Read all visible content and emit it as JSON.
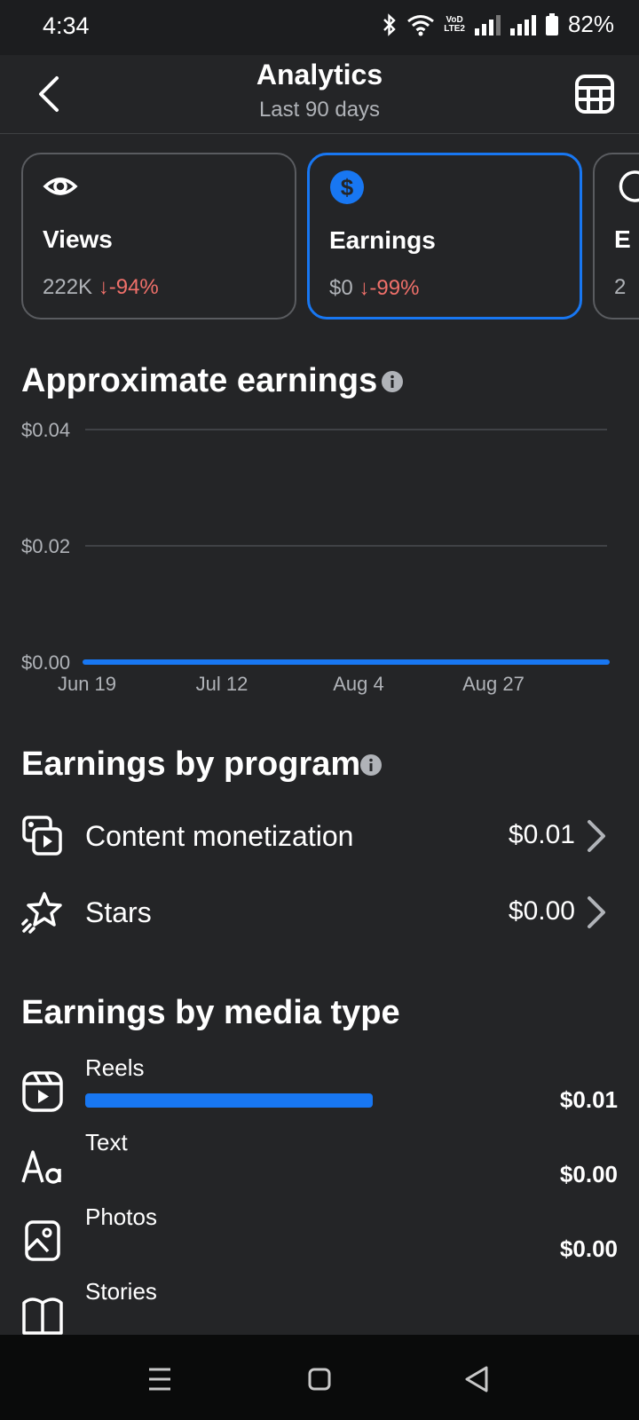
{
  "status": {
    "time": "4:34",
    "battery": "82%",
    "network_label_top": "VoD",
    "network_label_bottom": "LTE2"
  },
  "header": {
    "title": "Analytics",
    "subtitle": "Last 90 days"
  },
  "cards": [
    {
      "label": "Views",
      "value": "222K",
      "delta": "↓-94%",
      "icon": "eye-icon"
    },
    {
      "label": "Earnings",
      "value": "$0",
      "delta": "↓-99%",
      "icon": "dollar-icon",
      "selected": true
    },
    {
      "label": "E",
      "value": "2",
      "icon": "partial-icon"
    }
  ],
  "chart_section": {
    "title": "Approximate earnings"
  },
  "chart_data": {
    "type": "line",
    "title": "Approximate earnings",
    "x": [
      "Jun 19",
      "Jul 12",
      "Aug 4",
      "Aug 27"
    ],
    "y_ticks": [
      "$0.04",
      "$0.02",
      "$0.00"
    ],
    "ylim": [
      0,
      0.04
    ],
    "series": [
      {
        "values": [
          0,
          0,
          0,
          0,
          0
        ]
      }
    ],
    "grid": true,
    "color": "#1877f2"
  },
  "programs": {
    "title": "Earnings by program",
    "items": [
      {
        "label": "Content monetization",
        "value": "$0.01",
        "icon": "content-monetization-icon"
      },
      {
        "label": "Stars",
        "value": "$0.00",
        "icon": "stars-icon"
      }
    ]
  },
  "media": {
    "title": "Earnings by media type",
    "items": [
      {
        "label": "Reels",
        "value": "$0.01",
        "share": 1.0,
        "icon": "reels-icon"
      },
      {
        "label": "Text",
        "value": "$0.00",
        "share": 0,
        "icon": "text-icon"
      },
      {
        "label": "Photos",
        "value": "$0.00",
        "share": 0,
        "icon": "photo-icon"
      },
      {
        "label": "Stories",
        "value": "",
        "share": 0,
        "icon": "stories-icon"
      }
    ]
  },
  "colors": {
    "accent": "#1877f2",
    "negative": "#f0706a",
    "background": "#242527"
  }
}
